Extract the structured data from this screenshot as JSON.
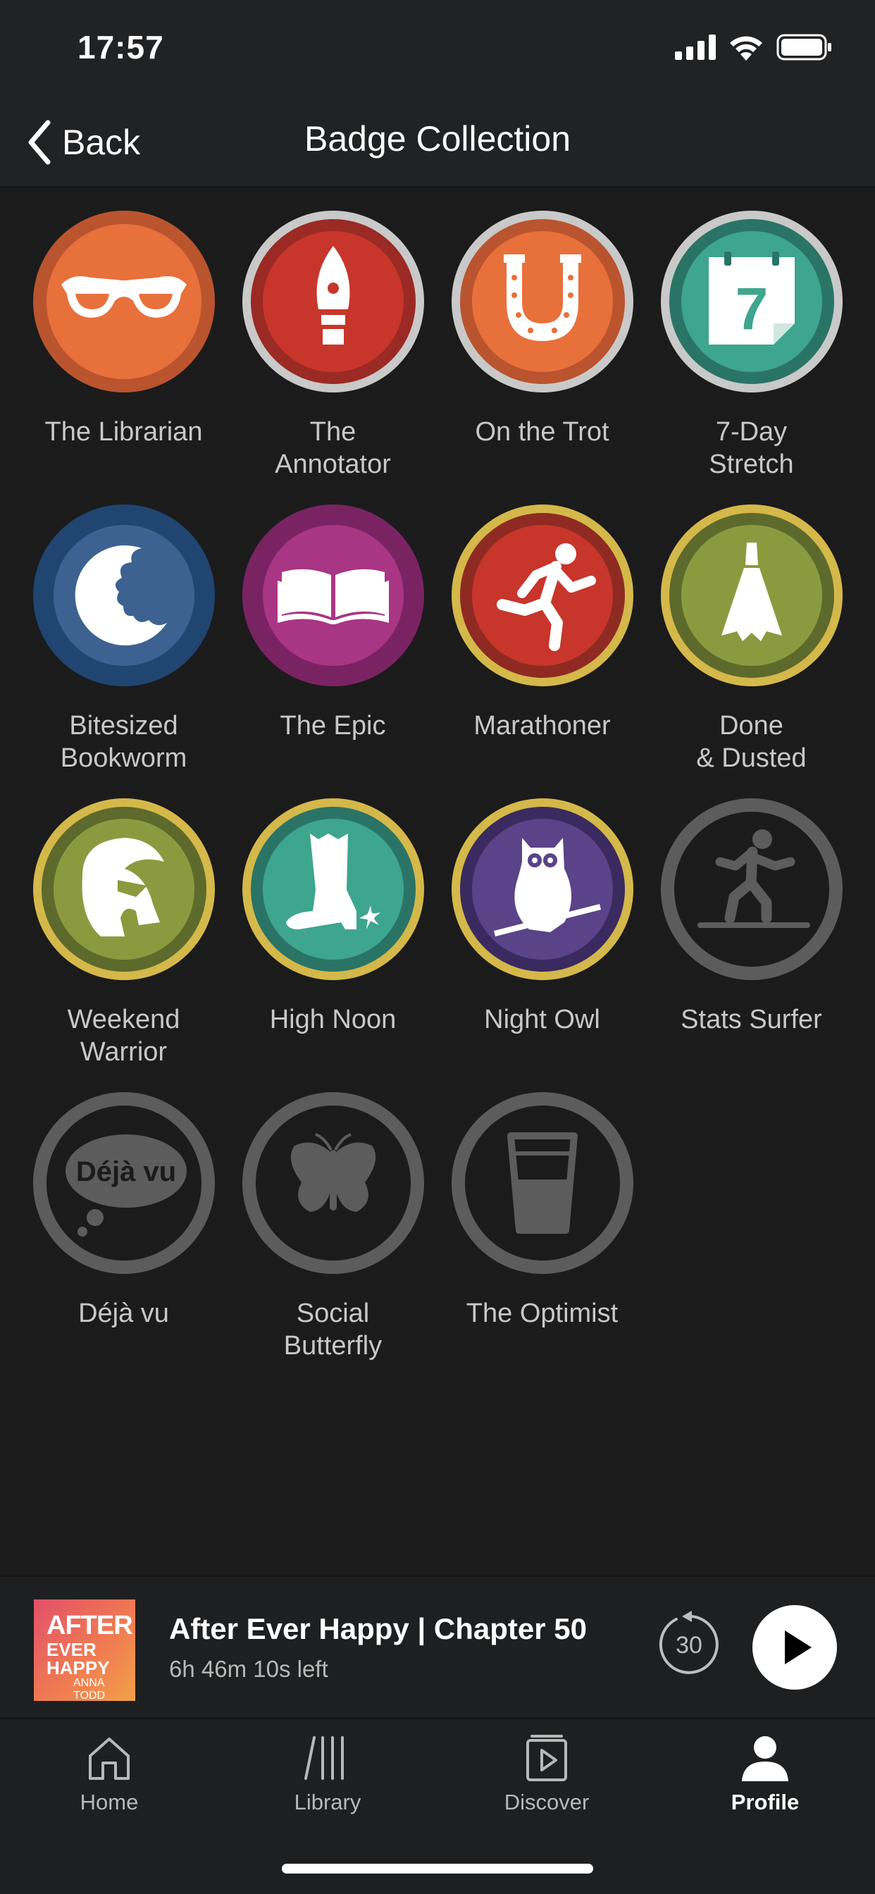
{
  "status_bar": {
    "time": "17:57"
  },
  "nav": {
    "back_label": "Back",
    "title": "Badge Collection"
  },
  "badges": [
    {
      "name": "The Librarian",
      "earned": true,
      "icon": "glasses-icon"
    },
    {
      "name": "The\nAnnotator",
      "earned": true,
      "icon": "fountain-pen-icon"
    },
    {
      "name": "On the Trot",
      "earned": true,
      "icon": "horseshoe-icon"
    },
    {
      "name": "7-Day\nStretch",
      "earned": true,
      "icon": "calendar-icon",
      "icon_text": "7"
    },
    {
      "name": "Bitesized\nBookworm",
      "earned": true,
      "icon": "bitten-cookie-icon"
    },
    {
      "name": "The Epic",
      "earned": true,
      "icon": "open-book-icon"
    },
    {
      "name": "Marathoner",
      "earned": true,
      "icon": "runner-icon"
    },
    {
      "name": "Done\n& Dusted",
      "earned": true,
      "icon": "broom-icon"
    },
    {
      "name": "Weekend\nWarrior",
      "earned": true,
      "icon": "spartan-helmet-icon"
    },
    {
      "name": "High Noon",
      "earned": true,
      "icon": "cowboy-boot-icon"
    },
    {
      "name": "Night Owl",
      "earned": true,
      "icon": "owl-icon"
    },
    {
      "name": "Stats Surfer",
      "earned": false,
      "icon": "surfer-icon"
    },
    {
      "name": "Déjà vu",
      "earned": false,
      "icon": "thought-bubble-icon",
      "icon_text": "Déjà vu"
    },
    {
      "name": "Social\nButterfly",
      "earned": false,
      "icon": "butterfly-icon"
    },
    {
      "name": "The Optimist",
      "earned": false,
      "icon": "half-glass-icon"
    }
  ],
  "player": {
    "cover": {
      "line1": "AFTER",
      "line2": "EVER",
      "line3": "HAPPY",
      "author": "ANNA TODD"
    },
    "title": "After Ever Happy | Chapter 50",
    "remaining": "6h 46m 10s left",
    "skip_back": "30"
  },
  "tabs": [
    {
      "label": "Home",
      "icon": "home-icon",
      "active": false
    },
    {
      "label": "Library",
      "icon": "library-icon",
      "active": false
    },
    {
      "label": "Discover",
      "icon": "discover-icon",
      "active": false
    },
    {
      "label": "Profile",
      "icon": "profile-icon",
      "active": true
    }
  ],
  "colors": {
    "background": "#1b1b1c",
    "bar": "#212223",
    "badge_locked": "#5c5c5c",
    "ring_silver": "#c9c9c9",
    "ring_gold": "#d4b84a"
  }
}
